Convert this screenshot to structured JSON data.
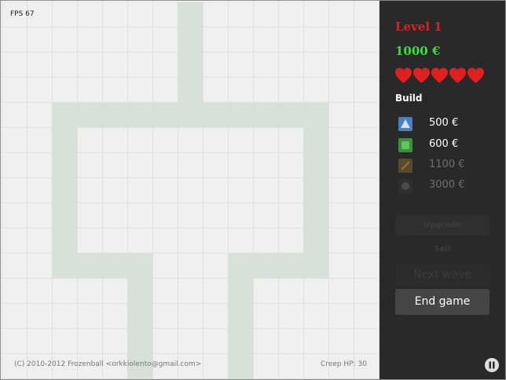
{
  "game": {
    "fps_text": "FPS 67",
    "copyright": "(C) 2010-2012 Frozenball <orkkiolento@gmail.com>",
    "creep_hp": "Creep HP: 30"
  },
  "panel": {
    "level": "Level 1",
    "money": "1000 €",
    "lives": 5,
    "build_label": "Build",
    "towers": [
      {
        "icon": "blue-triangle-tower-icon",
        "price": "500 €",
        "available": true
      },
      {
        "icon": "green-square-tower-icon",
        "price": "600 €",
        "available": true
      },
      {
        "icon": "brown-diagonal-tower-icon",
        "price": "1100 €",
        "available": false
      },
      {
        "icon": "dark-circle-tower-icon",
        "price": "3000 €",
        "available": false
      }
    ],
    "buttons": {
      "upgrade": "Upgrade",
      "sell": "Sell",
      "next_wave": "Next wave",
      "end_game": "End game"
    }
  },
  "colors": {
    "board_bg": "#efefef",
    "grid_line": "#e0e0e0",
    "path": "#d9e0d9",
    "panel_bg": "#292929",
    "level": "#e02020",
    "money": "#36e336",
    "heart": "#e02020"
  }
}
